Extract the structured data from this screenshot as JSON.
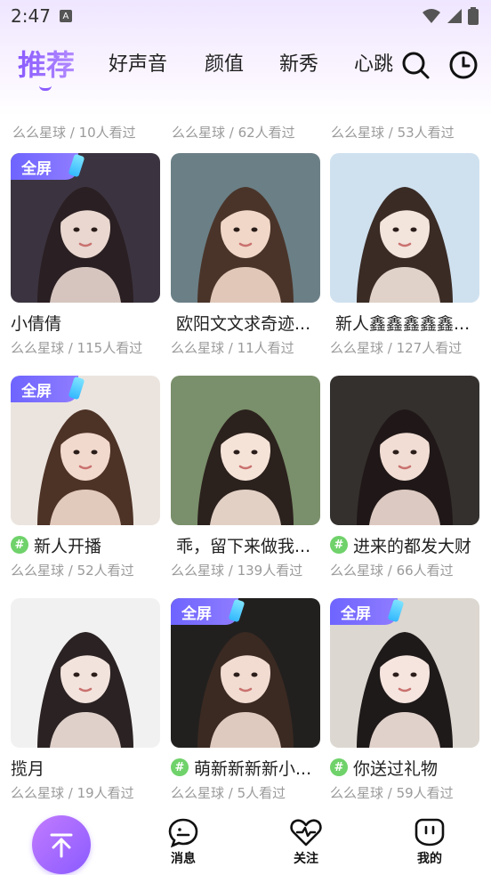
{
  "status_bar": {
    "time": "2:47",
    "notification_glyph": "A"
  },
  "tabs": [
    {
      "label": "推荐",
      "active": true
    },
    {
      "label": "好声音"
    },
    {
      "label": "颜值"
    },
    {
      "label": "新秀"
    },
    {
      "label": "心跳"
    }
  ],
  "icons": {
    "search": "search-icon",
    "history": "clock-icon"
  },
  "partial_row": [
    {
      "meta": "么么星球 / 10人看过"
    },
    {
      "meta": "么么星球 / 62人看过"
    },
    {
      "meta": "么么星球 / 53人看过"
    }
  ],
  "badge_label": "全屏",
  "hash_glyph": "#",
  "cards": [
    {
      "title": "小倩倩",
      "meta": "么么星球 / 115人看过",
      "fullscreen": true,
      "hash": false,
      "palette": [
        "#3b3440",
        "#e9d7d0",
        "#2a1f22"
      ]
    },
    {
      "title": "欧阳文文求奇迹...",
      "meta": "么么星球 / 11人看过",
      "fullscreen": false,
      "hash": false,
      "palette": [
        "#6b7f86",
        "#f1d7c8",
        "#4a3429"
      ]
    },
    {
      "title": "新人鑫鑫鑫鑫鑫...",
      "meta": "么么星球 / 127人看过",
      "fullscreen": false,
      "hash": false,
      "palette": [
        "#cfe1ef",
        "#f3e4dc",
        "#3a2b25"
      ]
    },
    {
      "title": "新人开播",
      "meta": "么么星球 / 52人看过",
      "fullscreen": true,
      "hash": true,
      "palette": [
        "#ebe4de",
        "#f2d9cd",
        "#4d3226"
      ]
    },
    {
      "title": "乖，留下来做我...",
      "meta": "么么星球 / 139人看过",
      "fullscreen": false,
      "hash": false,
      "palette": [
        "#7a8f6b",
        "#f6e3d8",
        "#2b211d"
      ]
    },
    {
      "title": "进来的都发大财",
      "meta": "么么星球 / 66人看过",
      "fullscreen": false,
      "hash": true,
      "palette": [
        "#34302e",
        "#f1ddd4",
        "#201818"
      ]
    },
    {
      "title": "揽月",
      "meta": "么么星球 / 19人看过",
      "fullscreen": false,
      "hash": false,
      "palette": [
        "#f2f1f1",
        "#f3e3dd",
        "#2b2323"
      ]
    },
    {
      "title": "萌新新新新小...",
      "meta": "么么星球 / 5人看过",
      "fullscreen": true,
      "hash": true,
      "palette": [
        "#22201f",
        "#f2dcd2",
        "#3b2a22"
      ]
    },
    {
      "title": "你送过礼物",
      "meta": "么么星球 / 59人看过",
      "fullscreen": true,
      "hash": true,
      "palette": [
        "#dcd7d0",
        "#f6e5df",
        "#1f1a1a"
      ]
    }
  ],
  "bottom_nav": [
    {
      "label": "",
      "icon": "arrow-up-icon"
    },
    {
      "label": "消息",
      "icon": "message-icon"
    },
    {
      "label": "关注",
      "icon": "heart-pulse-icon"
    },
    {
      "label": "我的",
      "icon": "profile-icon"
    }
  ],
  "colors": {
    "accent": "#8a5bff",
    "badge": "#6e64ff",
    "hash": "#6fd26a",
    "meta": "#9a9a9a"
  }
}
